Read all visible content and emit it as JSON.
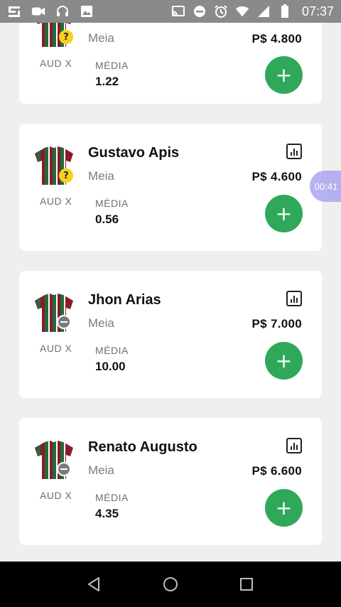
{
  "status_bar": {
    "time": "07:37",
    "icons": [
      "app-icon",
      "camera-icon",
      "headset-icon",
      "image-icon",
      "cast-icon",
      "dnd-icon",
      "alarm-icon",
      "wifi-icon",
      "signal-icon",
      "battery-icon"
    ]
  },
  "timer": {
    "label": "00:41"
  },
  "players": [
    {
      "name": "",
      "position": "Meia",
      "price": "P$ 4.800",
      "club": "AUD X",
      "avg_label": "MÉDIA",
      "avg": "1.22",
      "status": "doubt",
      "status_symbol": "?"
    },
    {
      "name": "Gustavo Apis",
      "position": "Meia",
      "price": "P$ 4.600",
      "club": "AUD X",
      "avg_label": "MÉDIA",
      "avg": "0.56",
      "status": "doubt",
      "status_symbol": "?"
    },
    {
      "name": "Jhon Arias",
      "position": "Meia",
      "price": "P$ 7.000",
      "club": "AUD X",
      "avg_label": "MÉDIA",
      "avg": "10.00",
      "status": "null"
    },
    {
      "name": "Renato Augusto",
      "position": "Meia",
      "price": "P$ 6.600",
      "club": "AUD X",
      "avg_label": "MÉDIA",
      "avg": "4.35",
      "status": "null"
    }
  ],
  "add_button_symbol": "+",
  "colors": {
    "accent_green": "#2fa85a",
    "doubt_yellow": "#f5d21a",
    "jersey_red": "#8b1a2b",
    "jersey_green": "#1f6b3a"
  }
}
